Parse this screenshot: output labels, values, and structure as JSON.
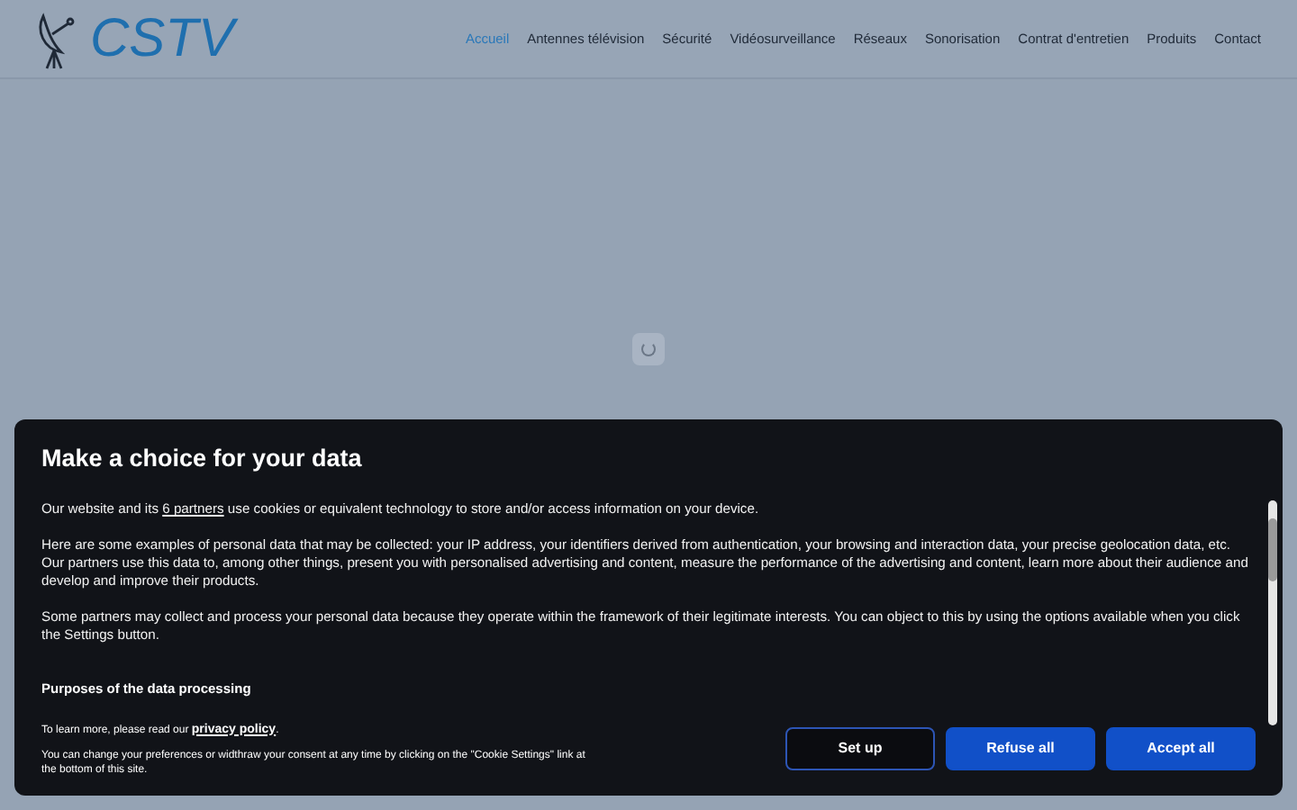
{
  "logo": {
    "text": "CSTV"
  },
  "nav": [
    {
      "label": "Accueil",
      "selected": true
    },
    {
      "label": "Antennes télévision",
      "selected": false
    },
    {
      "label": "Sécurité",
      "selected": false
    },
    {
      "label": "Vidéosurveillance",
      "selected": false
    },
    {
      "label": "Réseaux",
      "selected": false
    },
    {
      "label": "Sonorisation",
      "selected": false
    },
    {
      "label": "Contrat d'entretien",
      "selected": false
    },
    {
      "label": "Produits",
      "selected": false
    },
    {
      "label": "Contact",
      "selected": false
    }
  ],
  "consent": {
    "title": "Make a choice for your data",
    "intro_before": "Our website and its ",
    "intro_link": "6 partners",
    "intro_after": " use cookies or equivalent technology to store and/or access information on your device.",
    "paragraphs": [
      "Here are some examples of personal data that may be collected: your IP address, your identifiers derived from authentication, your browsing and interaction data, your precise geolocation data, etc.",
      "Our partners use this data to, among other things, present you with personalised advertising and content, measure the performance of the advertising and content, learn more about their audience and develop and improve their products.",
      "Some partners may collect and process your personal data because they operate within the framework of their legitimate interests. You can object to this by using the options available when you click the Settings button."
    ],
    "purposes_heading": "Purposes of the data processing",
    "learn_more": "To learn more, please read our ",
    "privacy_link": "privacy policy",
    "learn_more_end": ".",
    "change_note": "You can change your preferences or widthraw your consent at any time by clicking on the \"Cookie Settings\" link at the bottom of this site.",
    "buttons": [
      {
        "label": "Set up",
        "kind": "outline"
      },
      {
        "label": "Refuse all",
        "kind": "primary"
      },
      {
        "label": "Accept all",
        "kind": "primary"
      }
    ]
  }
}
